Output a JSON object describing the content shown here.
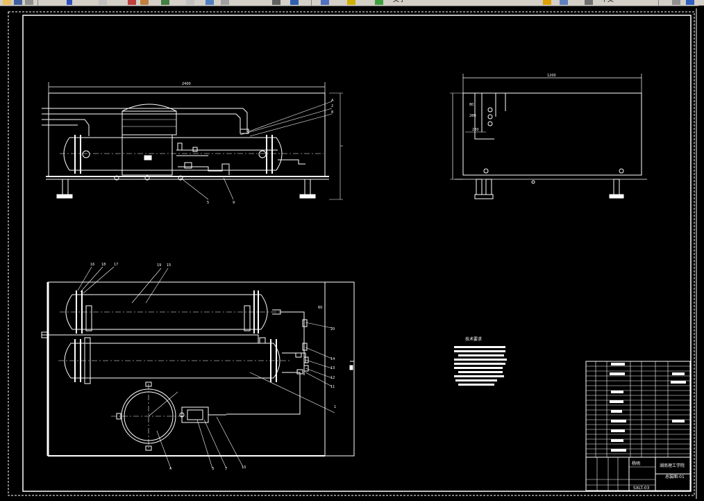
{
  "toolbar": {
    "text_label": "文字",
    "layer_label": "中文"
  },
  "drawing": {
    "front_view": {
      "dim_top": "2400",
      "balloons": [
        "A",
        "2",
        "8",
        "5",
        "9"
      ]
    },
    "side_view": {
      "dim_top": "1200",
      "dims": [
        "80",
        "280",
        "230"
      ]
    },
    "plan_view": {
      "balloons": [
        "16",
        "18",
        "17",
        "19",
        "15",
        "20",
        "14",
        "13",
        "12",
        "11",
        "1",
        "4",
        "3",
        "7",
        "10"
      ],
      "side_dim": "60"
    },
    "tech_notes": {
      "heading": "技术要求"
    },
    "title_block": {
      "designer": "杨明",
      "school": "湖南理工学院",
      "drawing_no": "总装图-01",
      "project": "SXLT-03"
    }
  }
}
